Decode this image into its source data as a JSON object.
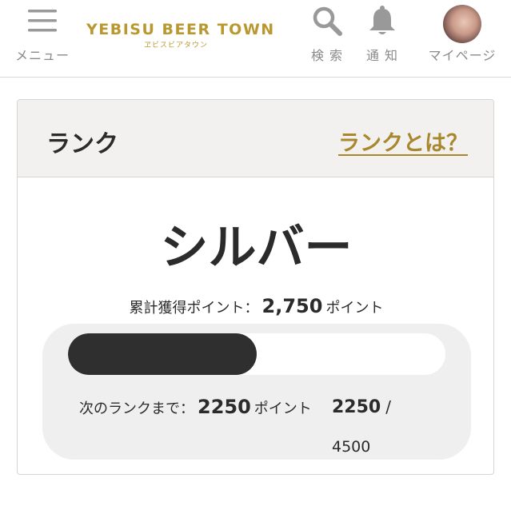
{
  "header": {
    "menu_label": "メニュー",
    "logo_main": "YEBISU BEER TOWN",
    "logo_sub": "ヱビスビアタウン",
    "search_label": "検 索",
    "notify_label": "通 知",
    "mypage_label": "マイページ"
  },
  "rank_card": {
    "title": "ランク",
    "link_label": "ランクとは？",
    "rank_name": "シルバー",
    "points_prefix": "累計獲得ポイント：",
    "points_value": "2,750",
    "points_unit": "ポイント",
    "next_prefix": "次のランクまで：",
    "next_value": "2250",
    "next_unit": "ポイント",
    "progress_current": "2250",
    "progress_separator": "/",
    "progress_total": "4500",
    "progress_fraction": 0.5
  },
  "colors": {
    "accent": "#b9982f",
    "link": "#a8872d",
    "progress_fill": "#2f2f2f",
    "card_header_bg": "#f2f1ef"
  },
  "icons": {
    "menu": "hamburger-icon",
    "search": "search-icon",
    "notify": "bell-icon",
    "mypage": "avatar"
  }
}
